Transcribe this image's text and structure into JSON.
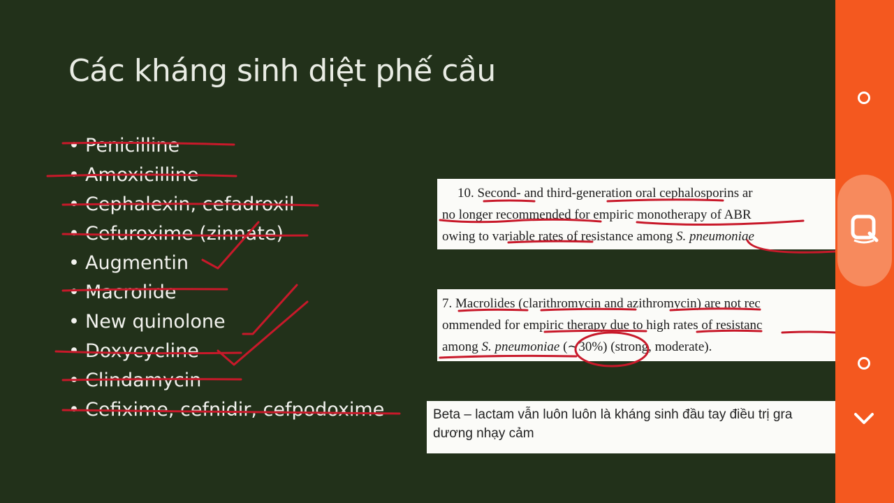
{
  "slide": {
    "title": "Các kháng sinh diệt phế cầu",
    "bullets": [
      {
        "text": "Penicilline",
        "struck": true
      },
      {
        "text": "Amoxicilline",
        "struck": true
      },
      {
        "text": "Cephalexin, cefadroxil",
        "struck": true
      },
      {
        "text": "Cefuroxime (zinnate)",
        "struck": true
      },
      {
        "text": "Augmentin",
        "struck": false
      },
      {
        "text": "Macrolide",
        "struck": true
      },
      {
        "text": "New quinolone",
        "struck": false
      },
      {
        "text": "Doxycycline",
        "struck": true
      },
      {
        "text": "Clindamycin",
        "struck": true
      },
      {
        "text": "Cefixime, cefnidir, cefpodoxime",
        "struck": true
      }
    ],
    "bullet_char": "•",
    "quote1": {
      "line1": "10. Second- and third-generation oral cephalosporins ar",
      "line2": "no longer recommended for empiric monotherapy of ABR",
      "line3_a": "owing to variable rates of resistance among ",
      "line3_b": "S. pneumoniae"
    },
    "quote2": {
      "line1": "7. Macrolides (clarithromycin and azithromycin) are not rec",
      "line2": "ommended for empiric therapy due to high rates of resistanc",
      "line3_a": "among ",
      "line3_b": "S. pneumoniae",
      "line3_c": " (∼30%) (strong, moderate)."
    },
    "note": {
      "line1": "Beta – lactam vẫn luôn luôn là kháng sinh đầu tay điều trị gra",
      "line2": "dương nhạy cảm"
    }
  },
  "colors": {
    "slide_bg": "#22311a",
    "annotation_ink": "#c8192a",
    "sidebar": "#f4581f"
  },
  "sidebar": {
    "icons": [
      "circle-icon",
      "note-search-icon",
      "circle-icon",
      "chevron-down-icon"
    ]
  }
}
